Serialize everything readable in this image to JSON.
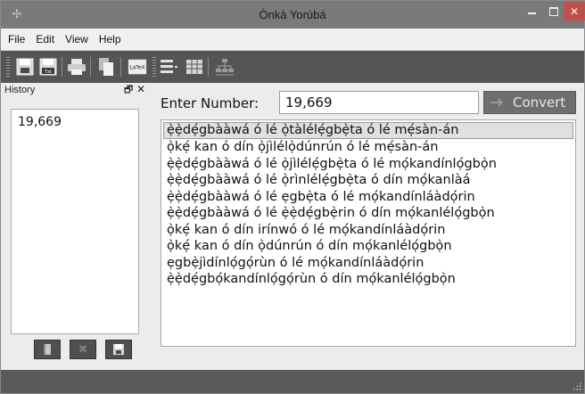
{
  "window": {
    "title": "Ònkà Yorùbá"
  },
  "menu": {
    "items": [
      "File",
      "Edit",
      "View",
      "Help"
    ]
  },
  "toolbar": {
    "icons": [
      "save-icon",
      "save-text-icon",
      "print-icon",
      "copy-icon",
      "latex-icon",
      "list-icon",
      "table-icon",
      "tree-icon"
    ],
    "latex_label": "LaTeX",
    "text_badge": "Txt"
  },
  "history": {
    "title": "History",
    "entries": [
      "19,669"
    ]
  },
  "input": {
    "label": "Enter Number:",
    "value": "19,669"
  },
  "convert": {
    "label": "Convert"
  },
  "results": [
    "ẹ̀ẹ̀dẹ́gbààwá ó lé ọ̀tàlélẹ́gbẹ̀ta ó lé mẹ́sàn-án",
    "ọ̀kẹ́ kan  ó dín ọ̀jìlélọ̀dúnrún ó lé mẹ́sàn-án",
    "ẹ̀ẹ̀dẹ́gbààwá ó lé ọ̀jìlélẹ́gbẹ̀ta ó lé mọ́kandínlọ́gbọ̀n",
    "ẹ̀ẹ̀dẹ́gbààwá ó lé ọ̀rìnlélẹ́gbẹ̀ta ó dín mọ́kanlàá",
    "ẹ̀ẹ̀dẹ́gbààwá ó lé ẹgbẹ̀ta ó lé mọ́kandínláàdọ́rin",
    "ẹ̀ẹ̀dẹ́gbààwá ó lé ẹ̀ẹ̀dẹ́gbẹ̀rin ó dín mọ́kanlélọ́gbọ̀n",
    "ọ̀kẹ́ kan  ó dín irínwó ó lé mọ́kandínláàdọ́rin",
    "ọ̀kẹ́ kan  ó dín ọ̀dúnrún ó dín mọ́kanlélọ́gbọ̀n",
    "ẹgbẹ̀jìdínlọ́gọ́rùn ó lé mọ́kandínláàdọ́rin",
    "ẹ̀ẹ̀dẹ́gbọ́kandínlọ́gọ́rùn ó dín mọ́kanlélọ́gbọ̀n"
  ],
  "colors": {
    "titlebar": "#7a7a7a",
    "toolbar": "#555555",
    "close": "#c0504d",
    "statusbar": "#5b5b5b"
  }
}
